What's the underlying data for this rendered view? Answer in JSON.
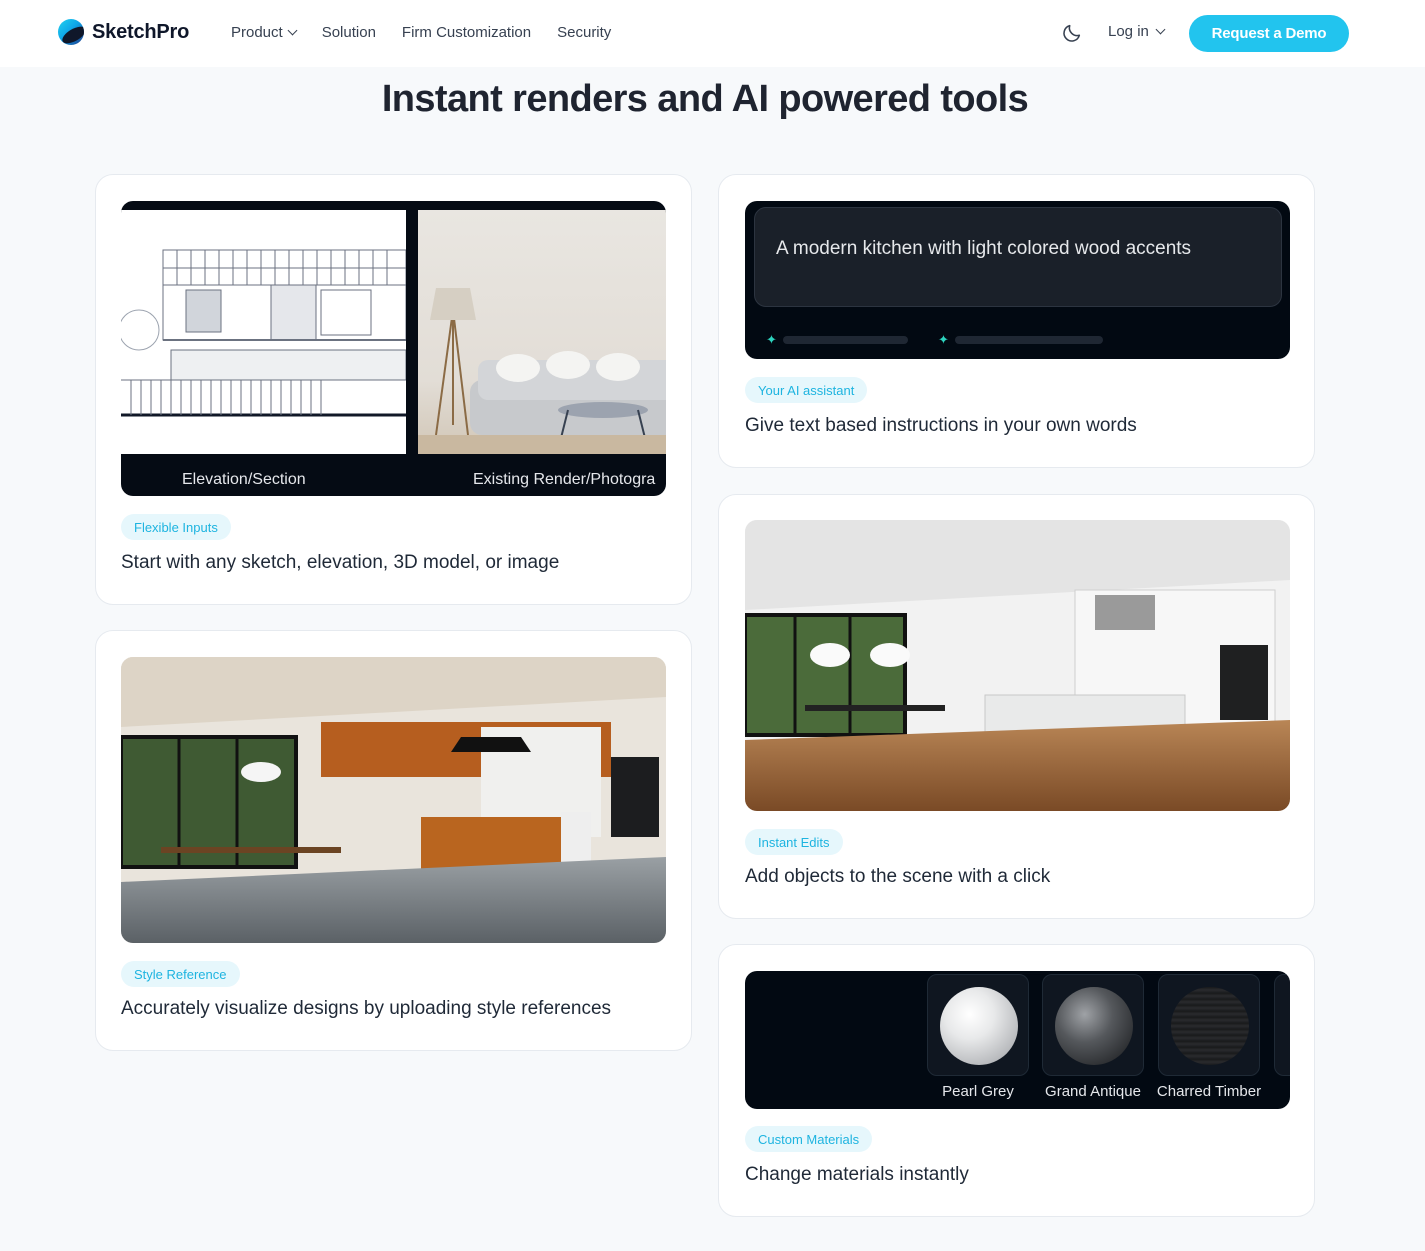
{
  "header": {
    "brand": "SketchPro",
    "nav": [
      {
        "label": "Product",
        "has_dropdown": true
      },
      {
        "label": "Solution",
        "has_dropdown": false
      },
      {
        "label": "Firm Customization",
        "has_dropdown": false
      },
      {
        "label": "Security",
        "has_dropdown": false
      }
    ],
    "login_label": "Log in",
    "demo_label": "Request a Demo",
    "accent_color": "#22c4ee"
  },
  "main": {
    "title": "Instant renders and AI powered tools",
    "cards": {
      "inputs": {
        "chip": "Flexible Inputs",
        "desc": "Start with any sketch, elevation, 3D model, or image",
        "left_label": "Elevation/Section",
        "right_label": "Existing Render/Photogra"
      },
      "assistant": {
        "chip": "Your AI assistant",
        "desc": "Give text based instructions in your own words",
        "prompt": "A modern kitchen with light colored wood accents"
      },
      "edits": {
        "chip": "Instant Edits",
        "desc": "Add objects to the scene with a click"
      },
      "style": {
        "chip": "Style Reference",
        "desc": "Accurately visualize designs by uploading style references"
      },
      "materials": {
        "chip": "Custom Materials",
        "desc": "Change materials instantly",
        "swatches": [
          "Pearl Grey",
          "Grand Antique",
          "Charred Timber"
        ]
      }
    }
  }
}
